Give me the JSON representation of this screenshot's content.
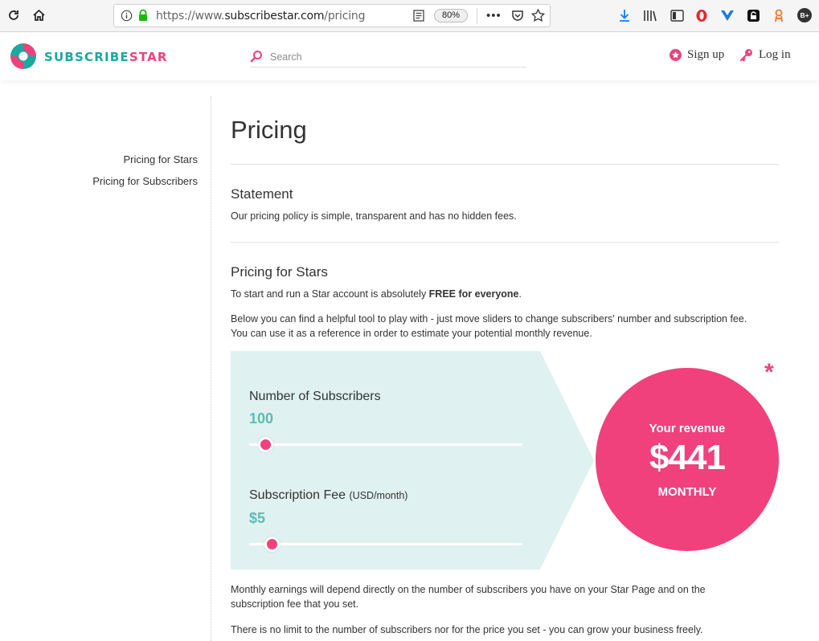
{
  "browser": {
    "url_scheme": "https://www.",
    "url_host": "subscribestar.com",
    "url_path": "/pricing",
    "zoom": "80%",
    "avatar_initials": "B+"
  },
  "header": {
    "logo_part1": "SUBSCRIBE",
    "logo_part2": "STAR",
    "search_placeholder": "Search",
    "signup_label": "Sign up",
    "login_label": "Log in"
  },
  "sidebar": {
    "items": [
      {
        "label": "Pricing for Stars"
      },
      {
        "label": "Pricing for Subscribers"
      }
    ]
  },
  "main": {
    "title": "Pricing",
    "statement_heading": "Statement",
    "statement_text": "Our pricing policy is simple, transparent and has no hidden fees.",
    "stars_heading": "Pricing for Stars",
    "stars_intro_prefix": "To start and run a Star account is absolutely ",
    "stars_intro_bold": "FREE for everyone",
    "stars_intro_suffix": ".",
    "tool_text_1": "Below you can find a helpful tool to play with - just move sliders to change subscribers' number and subscription fee.",
    "tool_text_2": "You can use it as a reference in order to estimate your potential monthly revenue.",
    "earnings_text_1": "Monthly earnings will depend directly on the number of subscribers you have on your Star Page and on the",
    "earnings_text_2": "subscription fee that you set.",
    "limit_text": "There is no limit to the number of subscribers nor for the price you set - you can grow your business freely."
  },
  "calculator": {
    "subscribers_label": "Number of Subscribers",
    "subscribers_value": "100",
    "subscribers_slider_fraction": 0.05,
    "fee_label": "Subscription Fee",
    "fee_unit": "(USD/month)",
    "fee_value": "$5",
    "fee_slider_fraction": 0.075,
    "revenue_title": "Your revenue",
    "revenue_amount": "$441",
    "revenue_period": "MONTHLY",
    "asterisk": "*"
  },
  "colors": {
    "brand_pink": "#f0417d",
    "brand_teal": "#1aa8a0",
    "calc_bg": "#dff1f0",
    "value_teal": "#5bbdb3"
  }
}
